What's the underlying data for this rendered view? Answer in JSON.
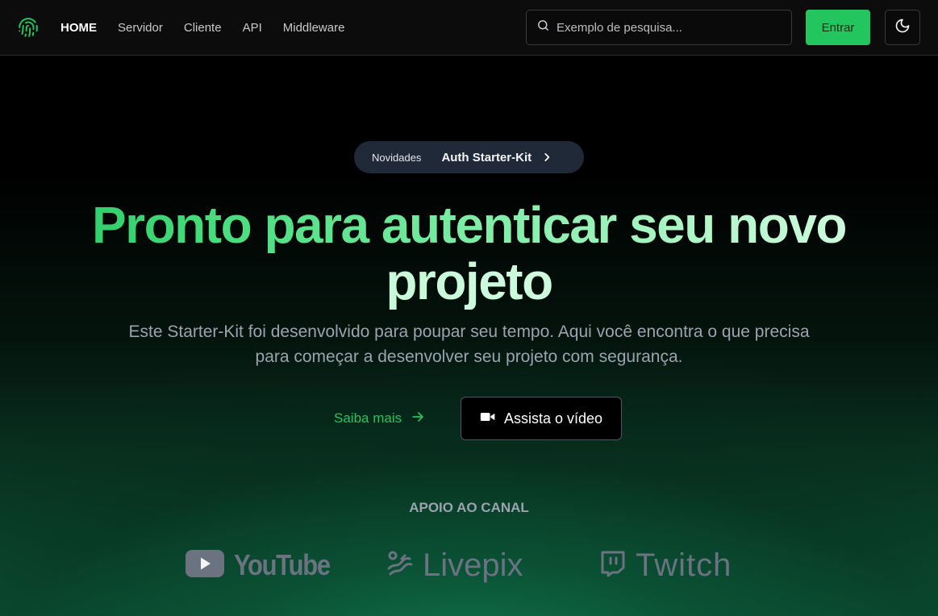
{
  "header": {
    "nav": [
      {
        "label": "HOME",
        "active": true
      },
      {
        "label": "Servidor",
        "active": false
      },
      {
        "label": "Cliente",
        "active": false
      },
      {
        "label": "API",
        "active": false
      },
      {
        "label": "Middleware",
        "active": false
      }
    ],
    "search": {
      "placeholder": "Exemplo de pesquisa..."
    },
    "login_label": "Entrar",
    "theme_icon": "moon-icon",
    "logo_icon": "fingerprint-icon"
  },
  "announcement": {
    "tag": "Novidades",
    "text": "Auth Starter-Kit"
  },
  "hero": {
    "title_line1": "Pronto para autenticar seu novo",
    "title_line2": "projeto",
    "subtitle": "Este Starter-Kit foi desenvolvido para poupar seu tempo. Aqui você encontra o que precisa para começar a desenvolver seu projeto com segurança."
  },
  "cta": {
    "learn_more": "Saiba mais",
    "watch_video": "Assista o vídeo"
  },
  "support": {
    "title": "APOIO AO CANAL",
    "sponsors": [
      {
        "name": "YouTube",
        "icon": "youtube-icon"
      },
      {
        "name": "Livepix",
        "icon": "livepix-icon"
      },
      {
        "name": "Twitch",
        "icon": "twitch-icon"
      }
    ]
  },
  "colors": {
    "accent": "#22c55e",
    "pill_bg": "#1f2937",
    "muted_text": "#9ca3af",
    "sponsor_gray": "#6b7280"
  }
}
